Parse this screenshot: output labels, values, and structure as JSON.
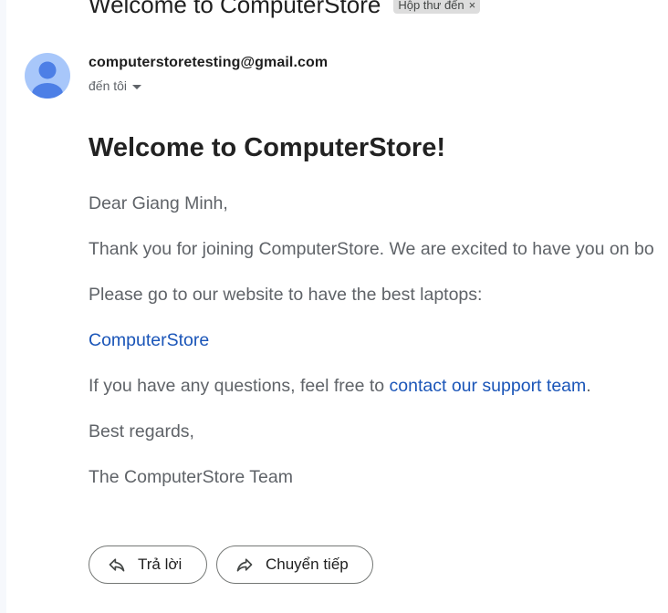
{
  "header": {
    "subject": "Welcome to ComputerStore",
    "label_chip": "Hộp thư đến",
    "label_remove": "×"
  },
  "sender": {
    "email": "computerstoretesting@gmail.com",
    "recipient_text": "đến tôi"
  },
  "message": {
    "heading": "Welcome to ComputerStore!",
    "greeting": "Dear Giang Minh,",
    "para_thanks": "Thank you for joining ComputerStore. We are excited to have you on bo",
    "para_website": "Please go to our website to have the best laptops:",
    "store_link": "ComputerStore",
    "questions_prefix": "If you have any questions, feel free to ",
    "support_link": "contact our support team",
    "questions_suffix": ".",
    "closing": "Best regards,",
    "signature": "The ComputerStore Team"
  },
  "actions": {
    "reply_label": "Trả lời",
    "forward_label": "Chuyển tiếp"
  },
  "colors": {
    "link": "#1a55b8",
    "avatar_bg": "#a8c7fa",
    "avatar_fg": "#4d7fe6",
    "body_text": "#5f6368"
  },
  "icons": {
    "avatar": "default-person-icon",
    "reply": "reply-arrow-icon",
    "forward": "forward-arrow-icon",
    "recipient_dropdown": "caret-down-icon"
  }
}
